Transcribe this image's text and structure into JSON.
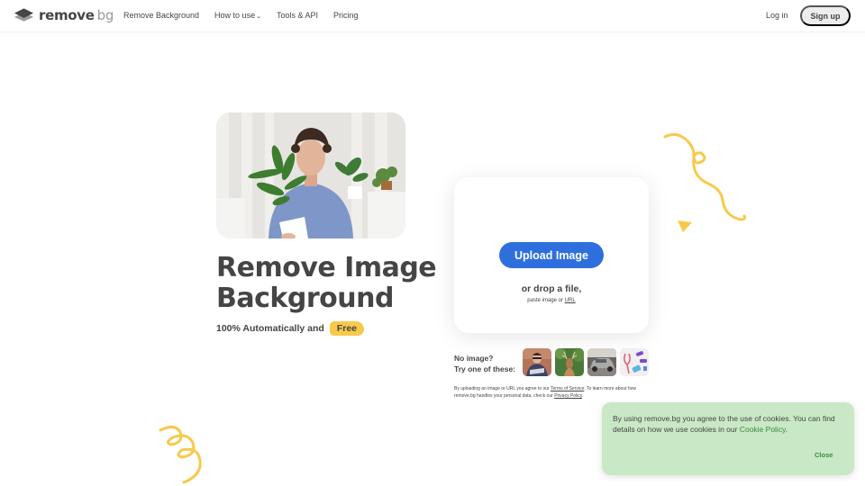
{
  "header": {
    "logo_main": "remove",
    "logo_suffix": "bg",
    "nav": [
      {
        "label": "Remove Background"
      },
      {
        "label": "How to use",
        "has_dropdown": true
      },
      {
        "label": "Tools & API"
      },
      {
        "label": "Pricing"
      }
    ],
    "login_label": "Log in",
    "signup_label": "Sign up",
    "chevron_glyph": "⌄"
  },
  "hero": {
    "headline_line1": "Remove Image",
    "headline_line2": "Background",
    "subline": "100% Automatically and",
    "free_badge": "Free"
  },
  "upload": {
    "button_label": "Upload Image",
    "drop_text": "or drop a file,",
    "paste_prefix": "paste image or",
    "paste_link": "URL"
  },
  "samples": {
    "label_line1": "No image?",
    "label_line2": "Try one of these:",
    "thumbnails": [
      {
        "subject": "person"
      },
      {
        "subject": "deer"
      },
      {
        "subject": "car"
      },
      {
        "subject": "fitness-equipment"
      }
    ]
  },
  "legal": {
    "prefix": "By uploading an image or URL you agree to our",
    "terms_link": "Terms of Service",
    "middle": ". To learn more about how remove.bg handles your personal data, check our",
    "privacy_link": "Privacy Policy",
    "suffix": "."
  },
  "cookie": {
    "text": "By using remove.bg you agree to the use of cookies. You can find details on how we use cookies in our",
    "link": "Cookie Policy",
    "suffix": ".",
    "close_label": "Close"
  },
  "colors": {
    "primary": "#2e6fdd",
    "accent_yellow": "#f8c94a",
    "cookie_bg": "#c9e8c5",
    "cookie_link": "#3a8a3a",
    "text": "#454545"
  }
}
